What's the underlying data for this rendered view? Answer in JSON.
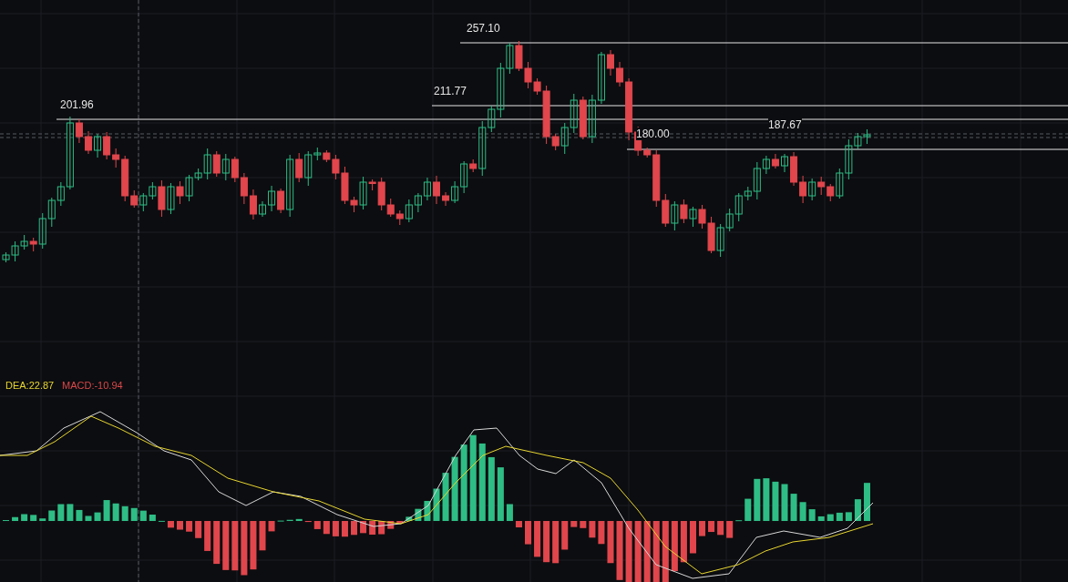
{
  "price_labels": [
    {
      "text": "201.96"
    },
    {
      "text": "257.10"
    },
    {
      "text": "211.77"
    },
    {
      "text": "180.00"
    },
    {
      "text": "187.67"
    }
  ],
  "indicator_legend": [
    {
      "text": "DEA:22.87",
      "color": "#e8d630"
    },
    {
      "text": "MACD:-10.94",
      "color": "#d9484a"
    }
  ]
}
